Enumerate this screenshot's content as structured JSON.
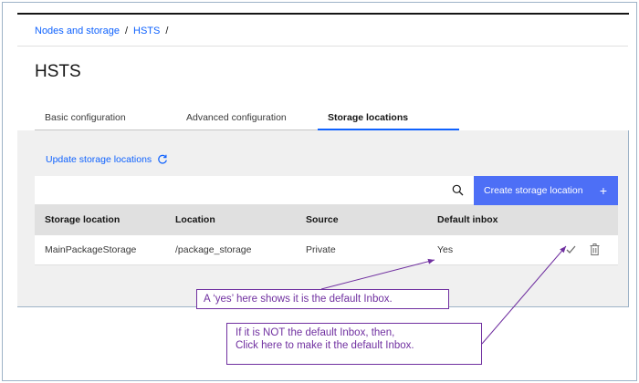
{
  "breadcrumb": {
    "items": [
      "Nodes and storage",
      "HSTS"
    ],
    "separator": "/"
  },
  "page": {
    "title": "HSTS"
  },
  "tabs": [
    {
      "label": "Basic configuration"
    },
    {
      "label": "Advanced configuration"
    },
    {
      "label": "Storage locations",
      "selected": true
    }
  ],
  "toolbar": {
    "update_label": "Update storage locations",
    "create_label": "Create storage location",
    "create_icon": "+"
  },
  "table": {
    "headers": [
      "Storage location",
      "Location",
      "Source",
      "Default inbox"
    ],
    "rows": [
      [
        "MainPackageStorage",
        "/package_storage",
        "Private",
        "Yes"
      ]
    ]
  },
  "annotations": {
    "callout1": "A ‘yes’ here shows it is the default Inbox.",
    "callout2_line1": "If it is NOT the default Inbox, then,",
    "callout2_line2": "Click here to make it the default Inbox."
  },
  "colors": {
    "accent": "#0f62fe",
    "button": "#4d6ff6",
    "annotation": "#7030a0"
  },
  "icons": [
    "refresh-icon",
    "search-icon",
    "check-icon",
    "trash-icon"
  ]
}
